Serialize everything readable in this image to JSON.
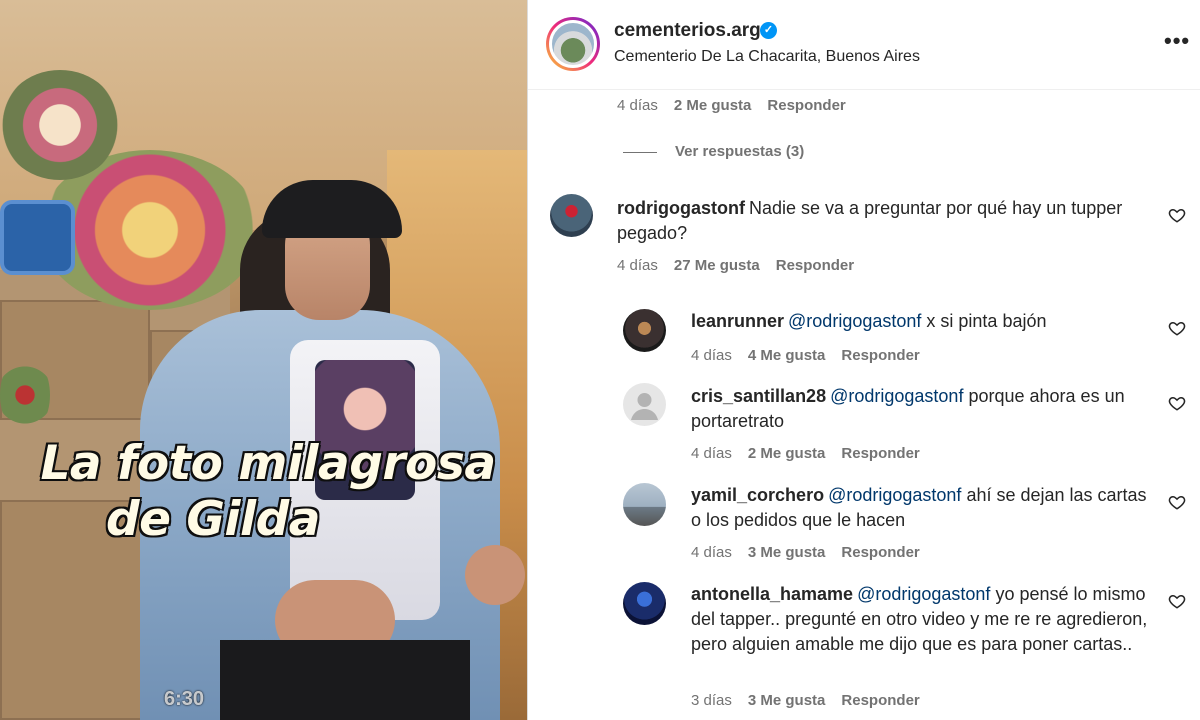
{
  "video": {
    "caption_line1": "La foto milagrosa",
    "caption_line2": "de Gilda",
    "timecode": "6:30"
  },
  "post_header": {
    "username": "cementerios.arg",
    "verified": true,
    "location": "Cementerio De La Chacarita, Buenos Aires",
    "more_icon": "more-horizontal-icon"
  },
  "top_meta": {
    "time": "4 días",
    "likes": "2 Me gusta",
    "reply": "Responder"
  },
  "view_replies": "Ver respuestas (3)",
  "comments": [
    {
      "username": "rodrigogastonf",
      "text": "Nadie se va a preguntar por qué hay un tupper pegado?",
      "time": "4 días",
      "likes": "27 Me gusta",
      "reply": "Responder"
    }
  ],
  "replies": [
    {
      "username": "leanrunner",
      "mention": "@rodrigogastonf",
      "text": "x si pinta bajón",
      "time": "4 días",
      "likes": "4 Me gusta",
      "reply": "Responder"
    },
    {
      "username": "cris_santillan28",
      "mention": "@rodrigogastonf",
      "text": "porque ahora es un portaretrato",
      "time": "4 días",
      "likes": "2 Me gusta",
      "reply": "Responder"
    },
    {
      "username": "yamil_corchero",
      "mention": "@rodrigogastonf",
      "text": "ahí se dejan las cartas o los pedidos que le hacen",
      "time": "4 días",
      "likes": "3 Me gusta",
      "reply": "Responder"
    },
    {
      "username": "antonella_hamame",
      "mention": "@rodrigogastonf",
      "text": "yo pensé lo mismo del tapper.. pregunté en otro video y me re re agredieron, pero alguien amable me dijo que es para poner cartas..",
      "time": "3 días",
      "likes": "3 Me gusta",
      "reply": "Responder"
    }
  ],
  "colors": {
    "text": "#262626",
    "secondary": "#737373",
    "mention": "#00376b",
    "verified": "#0095f6"
  }
}
